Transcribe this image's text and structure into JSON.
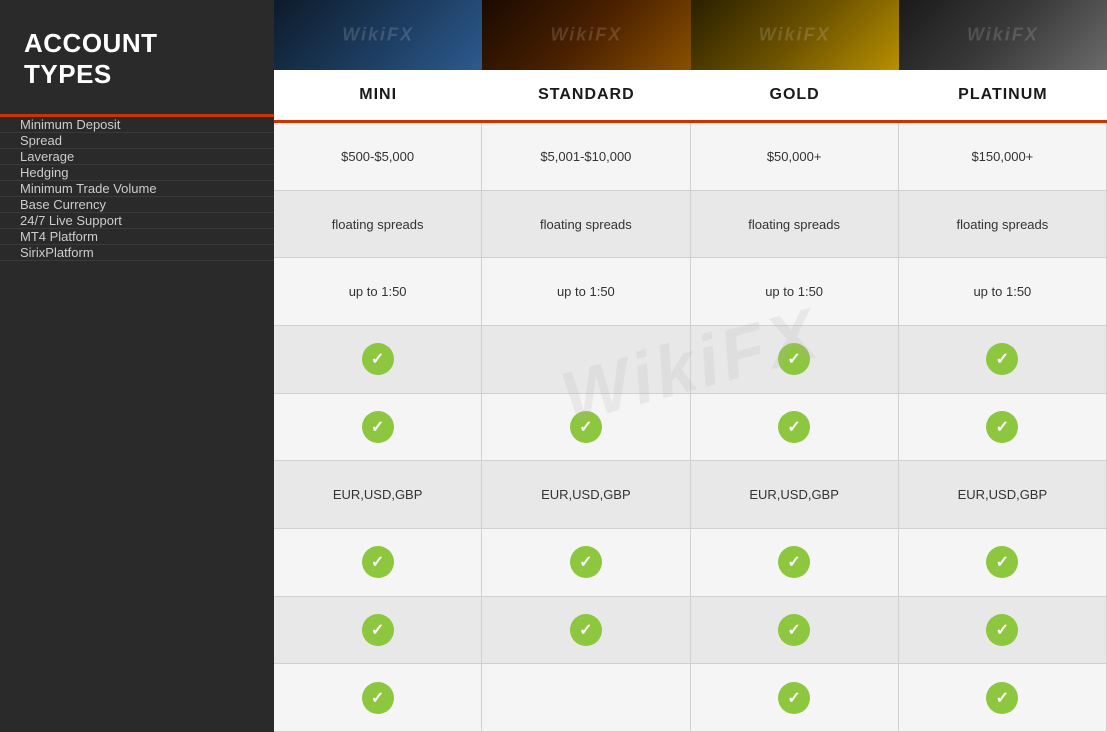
{
  "sidebar": {
    "title": "ACCOUNT TYPES"
  },
  "columns": {
    "headers": [
      "MINI",
      "STANDARD",
      "GOLD",
      "PLATINUM"
    ]
  },
  "rows": [
    {
      "label": "Minimum Deposit",
      "cells": [
        "$500-$5,000",
        "$5,001-$10,000",
        "$50,000+",
        "$150,000+"
      ],
      "type": "text"
    },
    {
      "label": "Spread",
      "cells": [
        "floating spreads",
        "floating spreads",
        "floating spreads",
        "floating spreads"
      ],
      "type": "text"
    },
    {
      "label": "Laverage",
      "cells": [
        "up to 1:50",
        "up to 1:50",
        "up to 1:50",
        "up to 1:50"
      ],
      "type": "text"
    },
    {
      "label": "Hedging",
      "cells": [
        "check",
        "none",
        "check",
        "check"
      ],
      "type": "check"
    },
    {
      "label": "Minimum Trade Volume",
      "cells": [
        "check",
        "check",
        "check",
        "check"
      ],
      "type": "check"
    },
    {
      "label": "Base Currency",
      "cells": [
        "EUR,USD,GBP",
        "EUR,USD,GBP",
        "EUR,USD,GBP",
        "EUR,USD,GBP"
      ],
      "type": "text"
    },
    {
      "label": "24/7 Live Support",
      "cells": [
        "check",
        "check",
        "check",
        "check"
      ],
      "type": "check"
    },
    {
      "label": "MT4 Platform",
      "cells": [
        "check",
        "check",
        "check",
        "check"
      ],
      "type": "check"
    },
    {
      "label": "SirixPlatform",
      "cells": [
        "check",
        "none",
        "check",
        "check"
      ],
      "type": "check"
    }
  ],
  "watermark": "WikiFX"
}
